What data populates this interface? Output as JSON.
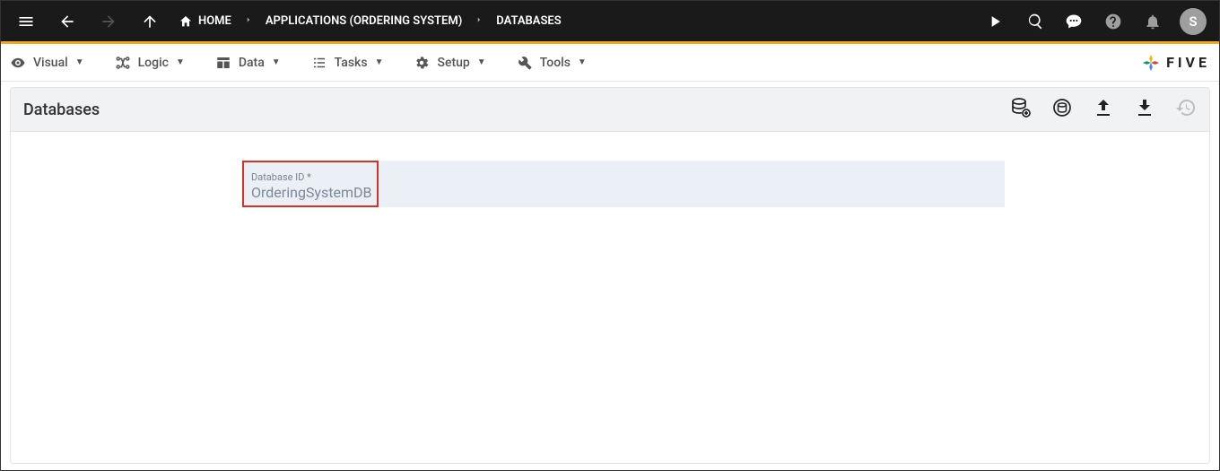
{
  "topbar": {
    "breadcrumb": {
      "home": "HOME",
      "app": "APPLICATIONS (ORDERING SYSTEM)",
      "section": "DATABASES"
    },
    "avatar_initial": "S"
  },
  "menu": {
    "visual": "Visual",
    "logic": "Logic",
    "data": "Data",
    "tasks": "Tasks",
    "setup": "Setup",
    "tools": "Tools"
  },
  "brand": {
    "text": "FIVE"
  },
  "page": {
    "title": "Databases"
  },
  "form": {
    "database_id_label": "Database ID *",
    "database_id_value": "OrderingSystemDB"
  },
  "icons": {
    "menu": "menu-icon",
    "back": "arrow-back-icon",
    "forward": "arrow-forward-icon",
    "up": "arrow-up-icon",
    "home": "home-icon",
    "chevron": "chevron-right-icon",
    "play": "play-icon",
    "search_chat": "magnify-chat-icon",
    "chat": "chat-icon",
    "help": "help-icon",
    "bell": "bell-icon",
    "eye": "eye-icon",
    "logic": "logic-icon",
    "grid": "grid-icon",
    "list": "tasks-icon",
    "gear": "gear-icon",
    "wrench": "tools-icon",
    "db_add": "database-add-icon",
    "refresh_db": "refresh-db-icon",
    "upload": "upload-icon",
    "download": "download-icon",
    "history": "history-icon"
  }
}
